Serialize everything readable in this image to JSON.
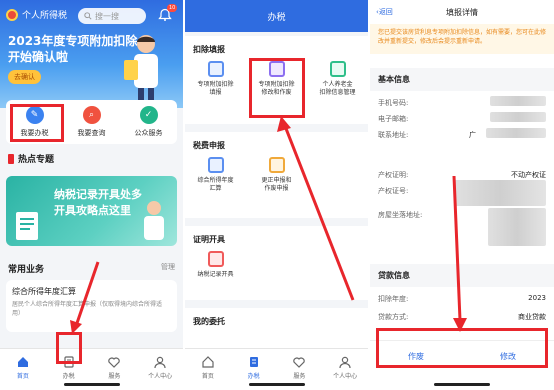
{
  "screen1": {
    "app_title": "个人所得税",
    "search_placeholder": "搜一搜",
    "badge_count": "10",
    "banner_line1": "2023年度专项附加扣除",
    "banner_line2": "开始确认啦",
    "banner_button": "去确认",
    "services": [
      {
        "label": "我要办税"
      },
      {
        "label": "我要查询"
      },
      {
        "label": "公众服务"
      }
    ],
    "hot_title": "热点专题",
    "hot_banner_line1": "纳税记录开具处多",
    "hot_banner_line2": "开具攻略点这里",
    "common_title": "常用业务",
    "common_manage": "管理",
    "common_item_title": "综合所得年度汇算",
    "common_item_desc": "居民个人综合所得年度汇算申报（仅取得境内综合所得适用）",
    "tabs": [
      {
        "label": "首页"
      },
      {
        "label": "办税"
      },
      {
        "label": "服务"
      },
      {
        "label": "个人中心"
      }
    ]
  },
  "screen2": {
    "title": "办税",
    "sections": [
      {
        "title": "扣除填报",
        "items": [
          {
            "label": "专项附加扣除\n填报"
          },
          {
            "label": "专项附加扣除\n修改和作废"
          },
          {
            "label": "个人养老金\n扣除信息管理"
          }
        ]
      },
      {
        "title": "税费申报",
        "items": [
          {
            "label": "综合所得年度\n汇算"
          },
          {
            "label": "更正申报和\n作废申报"
          },
          {
            "label": ""
          }
        ]
      },
      {
        "title": "证明开具",
        "items": [
          {
            "label": "纳税记录开具"
          },
          {
            "label": ""
          },
          {
            "label": ""
          }
        ]
      },
      {
        "title": "我的委托",
        "items": []
      }
    ],
    "tabs": [
      {
        "label": "首页"
      },
      {
        "label": "办税"
      },
      {
        "label": "服务"
      },
      {
        "label": "个人中心"
      }
    ]
  },
  "screen3": {
    "back": "返回",
    "title": "填报详情",
    "notice": "您已提交该房贷利息专项附加扣除信息，如有需要，您可在此修改并重新提交，修改后会提示重新申请。",
    "basic_title": "基本信息",
    "basic_rows": [
      {
        "label": "手机号码:",
        "value": ""
      },
      {
        "label": "电子邮箱:",
        "value": ""
      },
      {
        "label": "联系地址:",
        "value": "广"
      }
    ],
    "house_rows": [
      {
        "label": "产权证明:",
        "value": "不动产权证"
      },
      {
        "label": "产权证号:",
        "value": ""
      },
      {
        "label": "房屋坐落地址:",
        "value": ""
      }
    ],
    "loan_title": "贷款信息",
    "loan_rows": [
      {
        "label": "扣除年度:",
        "value": "2023"
      },
      {
        "label": "贷款方式:",
        "value": "商业贷款"
      }
    ],
    "btn_void": "作废",
    "btn_edit": "修改"
  },
  "colors": {
    "primary": "#2f6ce0",
    "highlight": "#e8262c"
  }
}
